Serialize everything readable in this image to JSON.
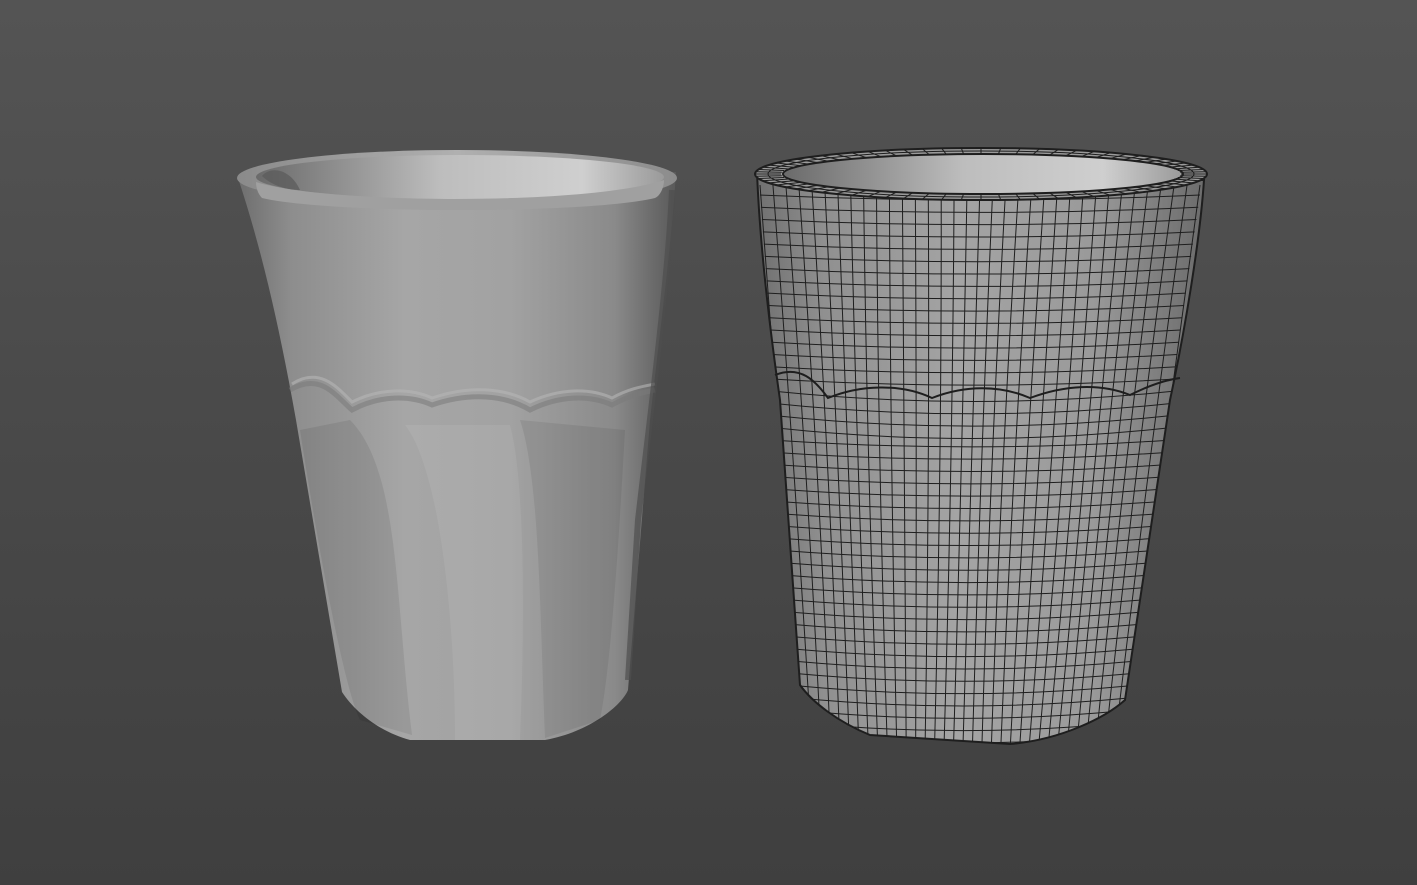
{
  "scene": {
    "background_top": "#545454",
    "background_bottom": "#3f3f3f",
    "cup_color": "#9a9a9a",
    "wire_color": "#1e1e1e",
    "objects": [
      {
        "name": "smooth-shaded-cup",
        "shading": "smooth"
      },
      {
        "name": "wireframe-cup",
        "shading": "wireframe-on-shaded"
      }
    ]
  }
}
